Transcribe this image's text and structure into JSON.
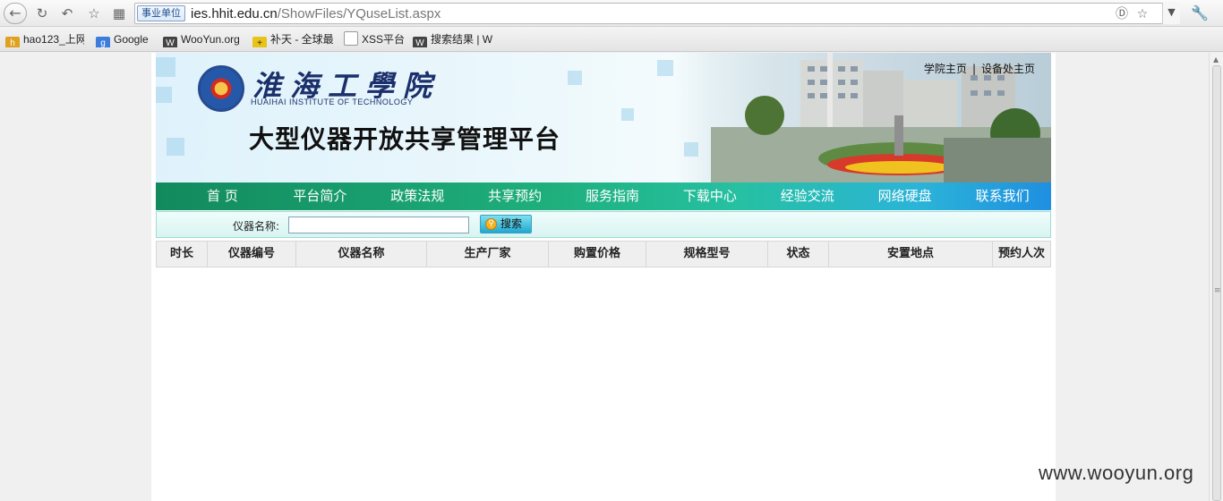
{
  "browser": {
    "cert_badge": "事业单位",
    "url_host": "ies.hhit.edu.cn",
    "url_path": "/ShowFiles/YQuseList.aspx",
    "icons": [
      "back-icon",
      "reload-icon",
      "undo-icon",
      "star-icon",
      "grid-icon",
      "ie-icon",
      "star-icon",
      "chevron-down-icon",
      "wrench-icon"
    ]
  },
  "bookmarks": [
    {
      "label": "hao123_上网",
      "icon": "hao123-icon",
      "color": "#e0a020"
    },
    {
      "label": "Google",
      "icon": "google-icon",
      "color": "#3b7ddd"
    },
    {
      "label": "WooYun.org",
      "icon": "wooyun-icon",
      "color": "#444444"
    },
    {
      "label": "补天 - 全球最",
      "icon": "butian-icon",
      "color": "#e8c418"
    },
    {
      "label": "XSS平台",
      "icon": "page-icon",
      "color": "#dddddd"
    },
    {
      "label": "搜索结果 | W",
      "icon": "wooyun-icon",
      "color": "#444444"
    }
  ],
  "header": {
    "logo_cn": "淮海工學院",
    "logo_en": "HUAIHAI INSTITUTE OF TECHNOLOGY",
    "site_title": "大型仪器开放共享管理平台",
    "link_college": "学院主页",
    "link_sep": "|",
    "link_equipment": "设备处主页"
  },
  "nav": {
    "items": [
      "首 页",
      "平台简介",
      "政策法规",
      "共享预约",
      "服务指南",
      "下载中心",
      "经验交流",
      "网络硬盘",
      "联系我们"
    ]
  },
  "search": {
    "label": "仪器名称:",
    "value": "",
    "button": "搜索"
  },
  "table": {
    "columns": [
      "时长",
      "仪器编号",
      "仪器名称",
      "生产厂家",
      "购置价格",
      "规格型号",
      "状态",
      "安置地点",
      "预约人次"
    ],
    "rows": []
  },
  "watermark": "www.wooyun.org"
}
